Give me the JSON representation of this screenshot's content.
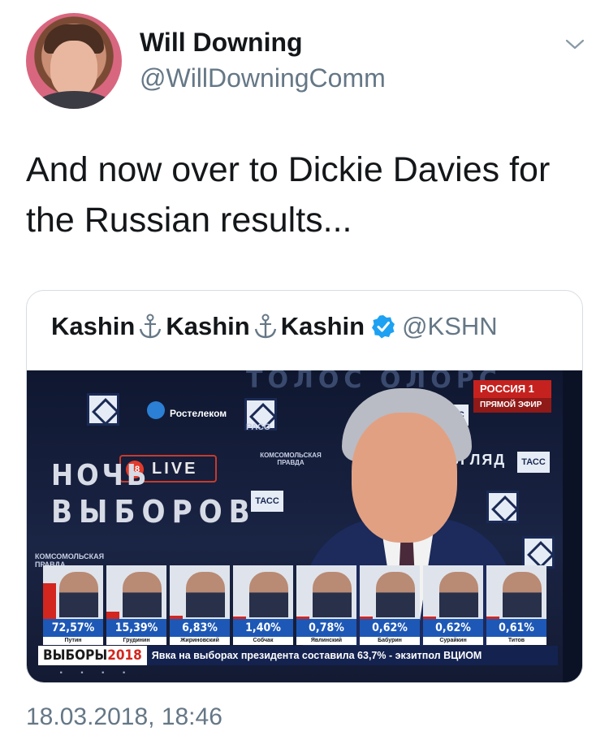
{
  "author": {
    "display_name": "Will Downing",
    "handle": "@WillDowningComm"
  },
  "tweet": {
    "text": "And now over to Dickie Davies for the Russian results...",
    "timestamp": "18.03.2018, 18:46"
  },
  "quoted": {
    "name_part": "Kashin",
    "separator_icon": "anchor-icon",
    "verified_icon": "verified-icon",
    "handle": "@KSHN"
  },
  "media": {
    "channel_badge": "РОССИЯ 1",
    "live_air": "ПРЯМОЙ ЭФИР",
    "show_title_line1": "НОЧЬ",
    "show_title_line2": "ВЫБОРОВ",
    "live_label": "LIVE",
    "live_number": "18",
    "sponsor_rostelecom": "Ростелеком",
    "sponsor_tass": "ТАСС",
    "sponsor_vzglyad": "ВЗГЛЯД",
    "sponsor_paco": "РАСО",
    "sponsor_kp": "КОМСОМОЛЬСКАЯ ПРАВДА",
    "candidates": [
      {
        "name": "Путин",
        "percent": "72,57%",
        "share": 72.57
      },
      {
        "name": "Грудинин",
        "percent": "15,39%",
        "share": 15.39
      },
      {
        "name": "Жириновский",
        "percent": "6,83%",
        "share": 6.83
      },
      {
        "name": "Собчак",
        "percent": "1,40%",
        "share": 1.4
      },
      {
        "name": "Явлинский",
        "percent": "0,78%",
        "share": 0.78
      },
      {
        "name": "Бабурин",
        "percent": "0,62%",
        "share": 0.62
      },
      {
        "name": "Сурайкин",
        "percent": "0,62%",
        "share": 0.62
      },
      {
        "name": "Титов",
        "percent": "0,61%",
        "share": 0.61
      }
    ],
    "ticker_brand": "ВЫБОРЫ",
    "ticker_year": "2018",
    "ticker_text": "Явка на выборах президента составила 63,7% - экзитпол ВЦИОМ"
  },
  "colors": {
    "accent_red": "#d3261f",
    "result_blue": "#1d58b6",
    "secondary_text": "#657786",
    "verified_blue": "#1da1f2"
  }
}
